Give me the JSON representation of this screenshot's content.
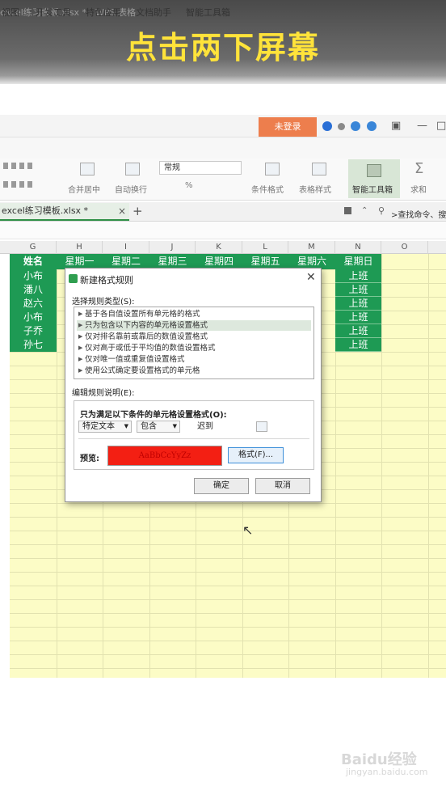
{
  "banner": {
    "text": "点击两下屏幕"
  },
  "window": {
    "title": "excel练习模板.xlsx * - WPS 表格",
    "login_button": "未登录"
  },
  "menubar": {
    "items": [
      "视图",
      "开发工具",
      "特色应用",
      "文档助手",
      "智能工具箱"
    ]
  },
  "ribbon": {
    "number_format": "常规",
    "labels": [
      "合并居中",
      "自动换行",
      "条件格式",
      "表格样式",
      "智能工具箱",
      "求和"
    ],
    "percent": "%"
  },
  "tabs": {
    "file_tab": "excel练习模板.xlsx *",
    "close": "×",
    "add": "+",
    "search": ">查找命令、搜"
  },
  "columns": [
    "G",
    "H",
    "I",
    "J",
    "K",
    "L",
    "M",
    "N",
    "O"
  ],
  "sheet": {
    "header": [
      "姓名",
      "星期一",
      "星期二",
      "星期三",
      "星期四",
      "星期五",
      "星期六",
      "星期日"
    ],
    "names": [
      "小布",
      "潘八",
      "赵六",
      "小布",
      "子乔",
      "孙七"
    ],
    "sunday": [
      "上班",
      "上班",
      "上班",
      "上班",
      "上班",
      "上班"
    ]
  },
  "dialog": {
    "title": "新建格式规则",
    "close": "✕",
    "rule_type_label": "选择规则类型(S):",
    "rule_types": [
      "基于各自值设置所有单元格的格式",
      "只为包含以下内容的单元格设置格式",
      "仅对排名靠前或靠后的数值设置格式",
      "仅对高于或低于平均值的数值设置格式",
      "仅对唯一值或重复值设置格式",
      "使用公式确定要设置格式的单元格"
    ],
    "selected_index": 1,
    "desc_label": "编辑规则说明(E):",
    "condition_label": "只为满足以下条件的单元格设置格式(O):",
    "condition_type": "特定文本",
    "operator": "包含",
    "value": "迟到",
    "preview_label": "预览:",
    "preview_text": "AaBbCcYyZz",
    "format_button": "格式(F)...",
    "ok_button": "确定",
    "cancel_button": "取消"
  },
  "watermark": {
    "brand": "Baidu经验",
    "url": "jingyan.baidu.com"
  },
  "colors": {
    "accent_green": "#1e9a54",
    "sheet_yellow": "#fcfcc6",
    "preview_red": "#f31f13",
    "banner_yellow": "#ffe33a"
  }
}
